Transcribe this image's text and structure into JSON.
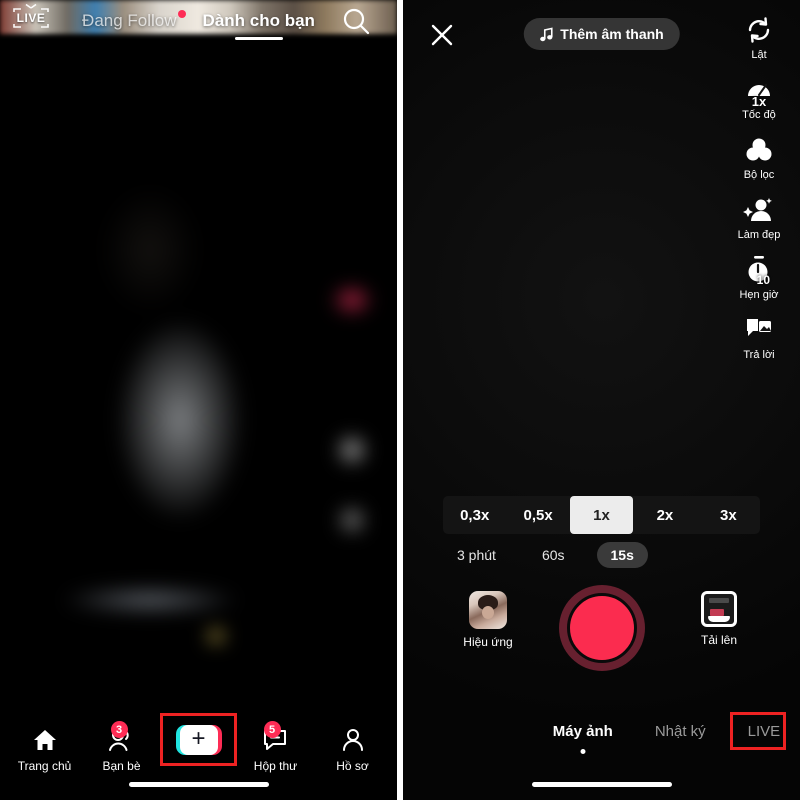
{
  "feed": {
    "live_badge": "LIVE",
    "tabs": [
      {
        "label": "Đang Follow",
        "active": false,
        "has_dot": true
      },
      {
        "label": "Dành cho bạn",
        "active": true,
        "has_dot": false
      }
    ],
    "search_icon": "search-icon",
    "nav": [
      {
        "label": "Trang chủ",
        "icon": "home-icon",
        "badge": ""
      },
      {
        "label": "Bạn bè",
        "icon": "friends-icon",
        "badge": "3"
      },
      {
        "label": "",
        "icon": "plus-create-icon",
        "badge": "",
        "highlighted": true
      },
      {
        "label": "Hộp thư",
        "icon": "inbox-icon",
        "badge": "5"
      },
      {
        "label": "Hồ sơ",
        "icon": "profile-icon",
        "badge": ""
      }
    ]
  },
  "camera": {
    "close_icon": "close-icon",
    "sound_button": {
      "label": "Thêm âm thanh",
      "icon": "music-note-icon"
    },
    "tools": [
      {
        "label": "Lật",
        "icon": "flip-camera-icon",
        "badge": ""
      },
      {
        "label": "Tốc độ",
        "icon": "speed-gauge-icon",
        "badge": "1x"
      },
      {
        "label": "Bộ lọc",
        "icon": "filter-circles-icon",
        "badge": ""
      },
      {
        "label": "Làm đẹp",
        "icon": "beautify-icon",
        "badge": ""
      },
      {
        "label": "Hẹn giờ",
        "icon": "timer-icon",
        "badge": "10"
      },
      {
        "label": "Trả lời",
        "icon": "reply-icon",
        "badge": ""
      }
    ],
    "speeds": [
      {
        "label": "0,3x",
        "active": false
      },
      {
        "label": "0,5x",
        "active": false
      },
      {
        "label": "1x",
        "active": true
      },
      {
        "label": "2x",
        "active": false
      },
      {
        "label": "3x",
        "active": false
      }
    ],
    "durations": [
      {
        "label": "3 phút",
        "active": false
      },
      {
        "label": "60s",
        "active": false
      },
      {
        "label": "15s",
        "active": true
      }
    ],
    "effects_button": {
      "label": "Hiệu ứng",
      "icon": "effects-thumbnail-icon"
    },
    "upload_button": {
      "label": "Tải lên",
      "icon": "upload-gallery-icon"
    },
    "record_button": {
      "name": "record-button",
      "color": "#fb2c4f",
      "ring_color": "#67202f"
    },
    "modes": [
      {
        "label": "Máy ảnh",
        "active": true,
        "highlighted": false
      },
      {
        "label": "Nhật ký",
        "active": false,
        "highlighted": false
      },
      {
        "label": "LIVE",
        "active": false,
        "highlighted": true
      }
    ]
  },
  "annotation": {
    "color": "#ee2222"
  }
}
